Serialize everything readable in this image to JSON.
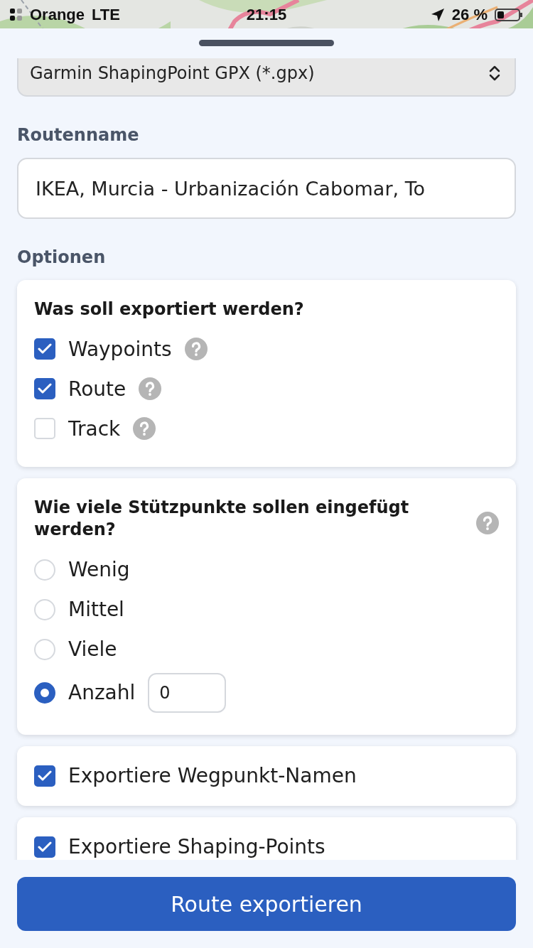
{
  "status_bar": {
    "carrier": "Orange",
    "network": "LTE",
    "time": "21:15",
    "battery": "26 %"
  },
  "format_select": {
    "value": "Garmin ShapingPoint GPX (*.gpx)"
  },
  "route_name": {
    "label": "Routenname",
    "value": "IKEA, Murcia - Urbanización Cabomar, To"
  },
  "options": {
    "label": "Optionen",
    "export_card": {
      "title": "Was soll exportiert werden?",
      "items": [
        {
          "label": "Waypoints",
          "checked": true
        },
        {
          "label": "Route",
          "checked": true
        },
        {
          "label": "Track",
          "checked": false
        }
      ]
    },
    "points_card": {
      "title": "Wie viele Stützpunkte sollen eingefügt werden?",
      "choices": [
        {
          "kind": "option",
          "label": "Wenig",
          "selected": false
        },
        {
          "kind": "option",
          "label": "Mittel",
          "selected": false
        },
        {
          "kind": "option",
          "label": "Viele",
          "selected": false
        },
        {
          "kind": "count",
          "label": "Anzahl",
          "selected": true,
          "value": "0"
        }
      ]
    },
    "toggles": [
      {
        "label": "Exportiere Wegpunkt-Namen",
        "checked": true
      },
      {
        "label": "Exportiere Shaping-Points",
        "checked": true
      }
    ]
  },
  "export_button": "Route exportieren"
}
